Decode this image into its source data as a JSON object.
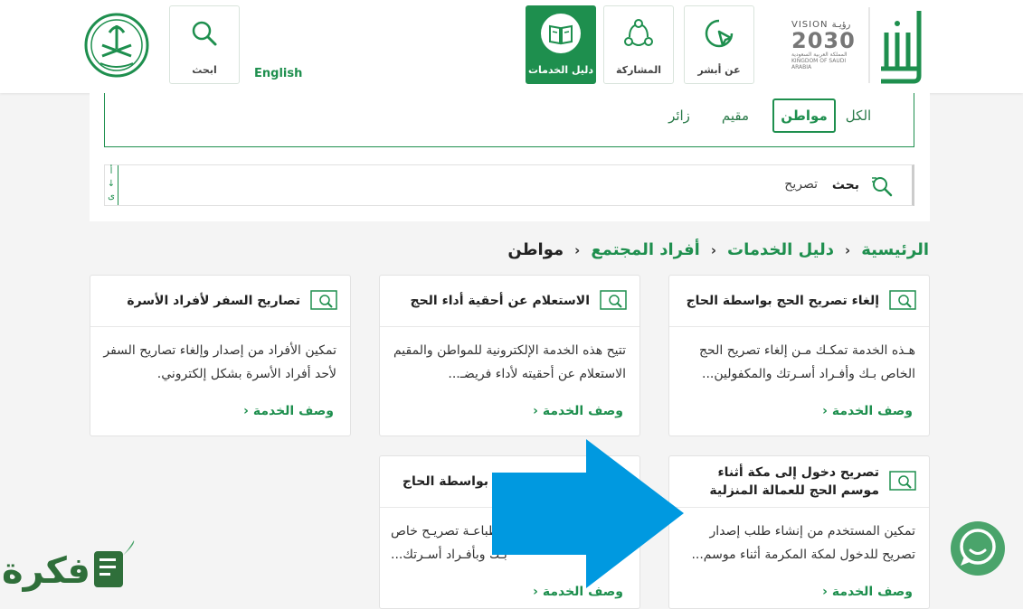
{
  "header": {
    "english_label": "English",
    "nav": {
      "search": "ابحث",
      "services_guide": "دليل الخدمات",
      "participation": "المشاركة",
      "about": "عن أبشر"
    },
    "vision": {
      "line1": "VISION رؤيـة",
      "line2": "2030",
      "line3": "المملكة العربية السعودية KINGDOM OF SAUDI ARABIA"
    },
    "brand_color": "#1e8f4e"
  },
  "filter": {
    "tabs": [
      "الكل",
      "مواطن",
      "مقيم",
      "زائر"
    ],
    "selected": "مواطن",
    "search_label": "بحث",
    "search_value": "تصريح",
    "side_letters": [
      "أ",
      "↓",
      "ى"
    ]
  },
  "breadcrumb": [
    "الرئيسية",
    "دليل الخدمات",
    "أفراد المجتمع",
    "مواطن"
  ],
  "cards": [
    {
      "title": "إلغاء تصريح الحج بواسطة الحاج",
      "desc": "هـذه الخدمة تمكـك مـن إلغاء تصريح الحج الخاص بـك وأفـراد أسـرتك والمكفولين...",
      "more": "وصف الخدمة"
    },
    {
      "title": "الاستعلام عن أحقية أداء الحج",
      "desc": "تتيح هذه الخدمة الإلكترونية للمواطن والمقيم الاستعلام عن أحقيته لأداء فريضـ...",
      "more": "وصف الخدمة"
    },
    {
      "title": "تصاريح السفر لأفراد الأسرة",
      "desc": "تمكين الأفراد من إصدار وإلغاء تصاريح السفر لأحد أفراد الأسرة بشكل إلكتروني.",
      "more": "وصف الخدمة"
    },
    {
      "title": "تصريح دخول إلى مكة أثناء موسم الحج للعمالة المنزلية",
      "desc": "تمكين المستخدم من إنشاء طلب إصدار تصريح للدخول لمكة المكرمة أثناء موسم...",
      "more": "وصف الخدمة"
    },
    {
      "title": "بواسطة الحاج",
      "desc": "ن طباعـة تصريـح خاص بـك وبأفـراد أسـرتك...",
      "more": "وصف الخدمة"
    }
  ],
  "watermark": "فكرة"
}
